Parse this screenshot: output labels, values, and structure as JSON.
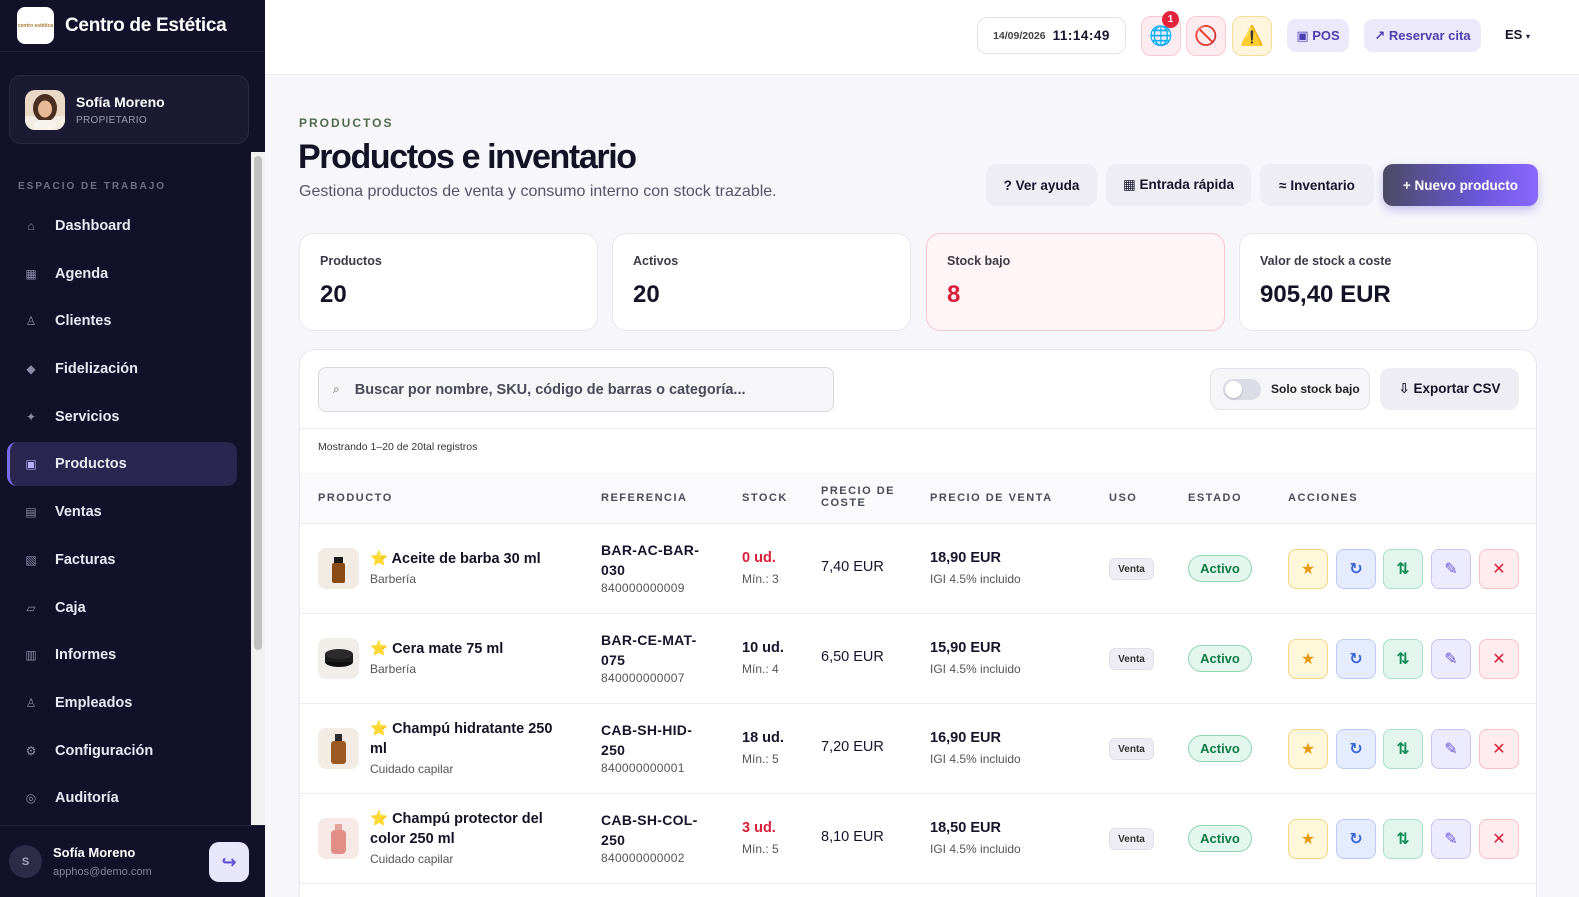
{
  "app": {
    "brand_title": "Centro de Estética",
    "logo_text": "centro estética"
  },
  "profile": {
    "name": "Sofía Moreno",
    "role": "PROPIETARIO"
  },
  "sidebar": {
    "section_label": "ESPACIO DE TRABAJO",
    "items": [
      {
        "label": "Dashboard",
        "icon": "⌂",
        "active": false
      },
      {
        "label": "Agenda",
        "icon": "▦",
        "active": false
      },
      {
        "label": "Clientes",
        "icon": "♙",
        "active": false
      },
      {
        "label": "Fidelización",
        "icon": "◆",
        "active": false
      },
      {
        "label": "Servicios",
        "icon": "✦",
        "active": false
      },
      {
        "label": "Productos",
        "icon": "▣",
        "active": true
      },
      {
        "label": "Ventas",
        "icon": "▤",
        "active": false
      },
      {
        "label": "Facturas",
        "icon": "▧",
        "active": false
      },
      {
        "label": "Caja",
        "icon": "▱",
        "active": false
      },
      {
        "label": "Informes",
        "icon": "▥",
        "active": false
      },
      {
        "label": "Empleados",
        "icon": "♙",
        "active": false
      },
      {
        "label": "Configuración",
        "icon": "⚙",
        "active": false
      },
      {
        "label": "Auditoría",
        "icon": "◎",
        "active": false
      }
    ],
    "footer_user_initial": "S",
    "footer_user_name": "Sofía Moreno",
    "footer_user_email": "apphos@demo.com"
  },
  "topbar": {
    "date": "14/09/2026",
    "time": "11:14:49",
    "notification_count": "1",
    "pos_label": "▣ POS",
    "reserve_label": "↗ Reservar cita",
    "language": "ES"
  },
  "header": {
    "eyebrow": "PRODUCTOS",
    "title": "Productos e inventario",
    "subtitle": "Gestiona productos de venta y consumo interno con stock trazable.",
    "help_label": "? Ver ayuda",
    "quick_entry_label": "▦ Entrada rápida",
    "inventory_label": "≈ Inventario",
    "new_product_label": "+ Nuevo producto"
  },
  "stats": [
    {
      "label": "Productos",
      "value": "20"
    },
    {
      "label": "Activos",
      "value": "20"
    },
    {
      "label": "Stock bajo",
      "value": "8"
    },
    {
      "label": "Valor de stock a coste",
      "value": "905,40 EUR"
    }
  ],
  "filters": {
    "search_placeholder": "Buscar por nombre, SKU, código de barras o categoría...",
    "low_stock_toggle_label": "Solo stock bajo",
    "low_stock_on": false,
    "export_label": "⇩ Exportar CSV",
    "showing_text": "Mostrando 1–20 de 20tal registros"
  },
  "table": {
    "columns": [
      "PRODUCTO",
      "REFERENCIA",
      "STOCK",
      "PRECIO DE COSTE",
      "PRECIO DE VENTA",
      "USO",
      "ESTADO",
      "ACCIONES"
    ],
    "rows": [
      {
        "name": "⭐ Aceite de barba 30 ml",
        "category": "Barbería",
        "ref": "BAR-AC-BAR-030",
        "barcode": "840000000009",
        "stock": "0 ud.",
        "stock_low": true,
        "min": "Mín.: 3",
        "cost": "7,40 EUR",
        "price": "18,90 EUR",
        "tax": "IGI 4.5% incluido",
        "use": "Venta",
        "status": "Activo"
      },
      {
        "name": "⭐ Cera mate 75 ml",
        "category": "Barbería",
        "ref": "BAR-CE-MAT-075",
        "barcode": "840000000007",
        "stock": "10 ud.",
        "stock_low": false,
        "min": "Mín.: 4",
        "cost": "6,50 EUR",
        "price": "15,90 EUR",
        "tax": "IGI 4.5% incluido",
        "use": "Venta",
        "status": "Activo"
      },
      {
        "name": "⭐ Champú hidratante 250 ml",
        "category": "Cuidado capilar",
        "ref": "CAB-SH-HID-250",
        "barcode": "840000000001",
        "stock": "18 ud.",
        "stock_low": false,
        "min": "Mín.: 5",
        "cost": "7,20 EUR",
        "price": "16,90 EUR",
        "tax": "IGI 4.5% incluido",
        "use": "Venta",
        "status": "Activo"
      },
      {
        "name": "⭐ Champú protector del color 250 ml",
        "category": "Cuidado capilar",
        "ref": "CAB-SH-COL-250",
        "barcode": "840000000002",
        "stock": "3 ud.",
        "stock_low": true,
        "min": "Mín.: 5",
        "cost": "8,10 EUR",
        "price": "18,50 EUR",
        "tax": "IGI 4.5% incluido",
        "use": "Venta",
        "status": "Activo"
      }
    ],
    "action_icons": {
      "favorite": "★",
      "restock": "↻",
      "move": "⇅",
      "edit": "✎",
      "delete": "✕"
    }
  },
  "colors": {
    "sidebar_bg": "#13112a",
    "accent": "#6a56d8",
    "danger": "#d81e3a",
    "success": "#0f7a45"
  }
}
